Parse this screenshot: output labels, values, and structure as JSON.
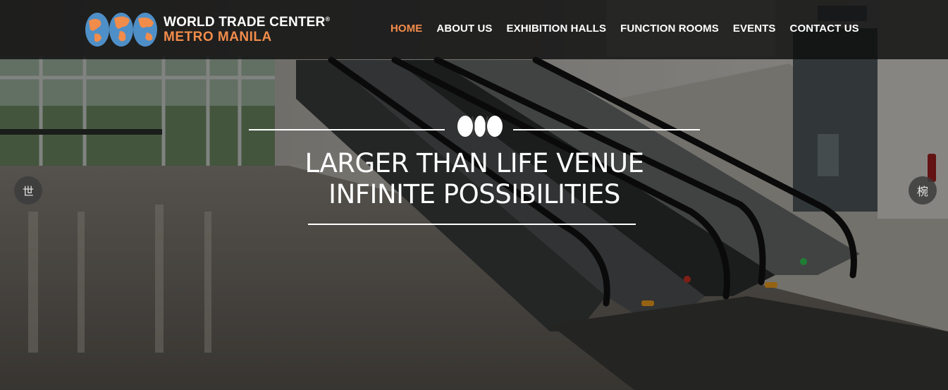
{
  "header": {
    "logo_line1": "WORLD TRADE CENTER",
    "logo_registered": "®",
    "logo_line2": "METRO MANILA"
  },
  "nav": {
    "items": [
      {
        "label": "HOME",
        "active": true
      },
      {
        "label": "ABOUT US",
        "active": false
      },
      {
        "label": "EXHIBITION HALLS",
        "active": false
      },
      {
        "label": "FUNCTION ROOMS",
        "active": false
      },
      {
        "label": "EVENTS",
        "active": false
      },
      {
        "label": "CONTACT US",
        "active": false
      }
    ]
  },
  "hero": {
    "headline_line1": "LARGER THAN LIFE VENUE",
    "headline_line2": "INFINITE POSSIBILITIES",
    "prev_glyph": "世",
    "next_glyph": "椀"
  },
  "colors": {
    "accent": "#f28c4b",
    "globe_blue": "#4f8fc7",
    "globe_orange": "#f28c4b",
    "text": "#ffffff"
  }
}
